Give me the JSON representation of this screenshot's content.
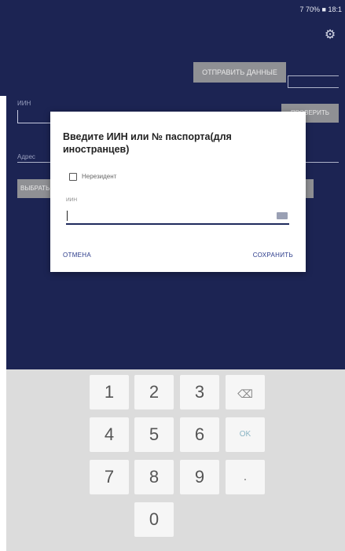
{
  "status_bar": {
    "text": "7 70% ■ 18:1"
  },
  "header": {
    "fetch_button": "ОТПРАВИТЬ ДАННЫЕ",
    "gear_icon": "gear-icon"
  },
  "form": {
    "name_label": "ИИН",
    "check_button": "ПРОВЕРИТЬ",
    "address_label": "Адрес",
    "select_button": "ВЫБРАТЬ"
  },
  "dialog": {
    "title": "Введите ИИН или № паспорта(для иностранцев)",
    "nonresident_label": "Нерезидент",
    "nonresident_checked": false,
    "iin_label": "ИИН",
    "iin_value": "",
    "cancel_label": "ОТМЕНА",
    "save_label": "СОХРАНИТЬ"
  },
  "keypad": {
    "keys": [
      "1",
      "2",
      "3",
      "4",
      "5",
      "6",
      "7",
      "8",
      "9",
      "0"
    ],
    "backspace_icon": "backspace-icon",
    "ok_label": "OK",
    "dot_label": "."
  }
}
